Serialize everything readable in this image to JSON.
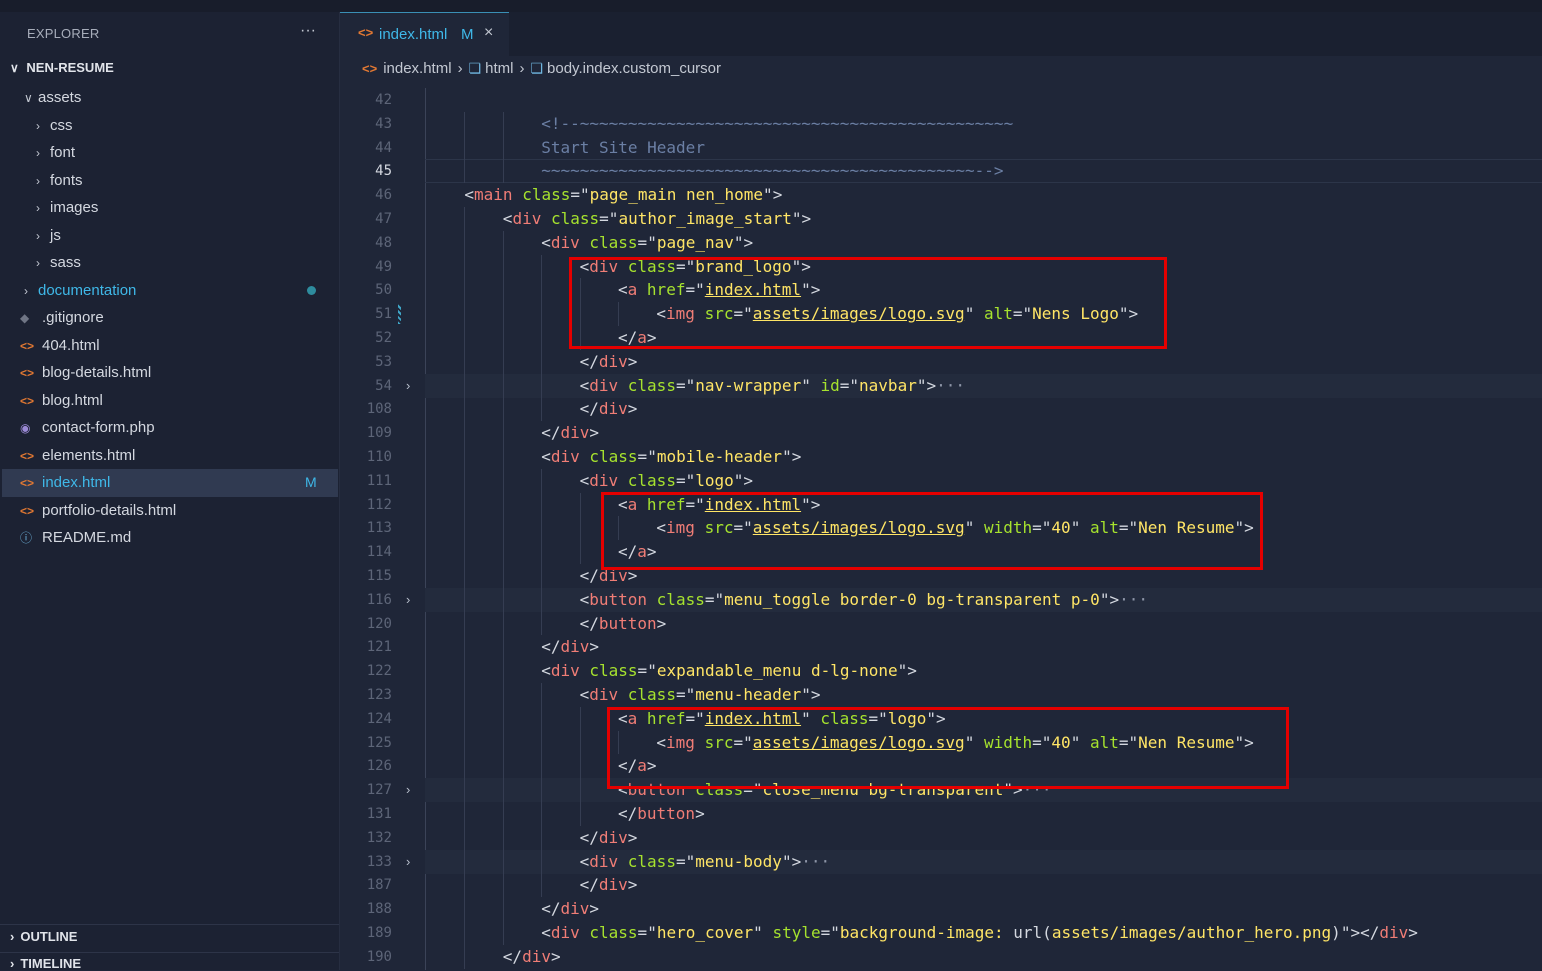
{
  "sidebar": {
    "header": "EXPLORER",
    "more": "···",
    "project": "NEN-RESUME",
    "items": [
      {
        "label": "assets",
        "type": "folder",
        "open": true
      },
      {
        "label": "css",
        "type": "folder"
      },
      {
        "label": "font",
        "type": "folder"
      },
      {
        "label": "fonts",
        "type": "folder"
      },
      {
        "label": "images",
        "type": "folder"
      },
      {
        "label": "js",
        "type": "folder"
      },
      {
        "label": "sass",
        "type": "folder"
      },
      {
        "label": "documentation",
        "type": "folder"
      },
      {
        "label": ".gitignore",
        "type": "file"
      },
      {
        "label": "404.html",
        "type": "file"
      },
      {
        "label": "blog-details.html",
        "type": "file"
      },
      {
        "label": "blog.html",
        "type": "file"
      },
      {
        "label": "contact-form.php",
        "type": "file"
      },
      {
        "label": "elements.html",
        "type": "file"
      },
      {
        "label": "index.html",
        "type": "file",
        "badge": "M"
      },
      {
        "label": "portfolio-details.html",
        "type": "file"
      },
      {
        "label": "README.md",
        "type": "file"
      }
    ],
    "outline": "OUTLINE",
    "timeline": "TIMELINE"
  },
  "editor": {
    "tab": {
      "label": "index.html",
      "badge": "M",
      "close": "×"
    },
    "breadcrumb": [
      "index.html",
      "html",
      "body.index.custom_cursor"
    ],
    "lines": [
      {
        "n": "42",
        "code": ""
      },
      {
        "n": "43",
        "code": "<!--~~~~~~~~~~~~~~~~~~~~~~~~~~~~~~~~~~~~~~~~~~~~~"
      },
      {
        "n": "44",
        "code": "Start Site Header"
      },
      {
        "n": "45",
        "code": "~~~~~~~~~~~~~~~~~~~~~~~~~~~~~~~~~~~~~~~~~~~~~-->"
      },
      {
        "n": "46",
        "code": "<main class=\"page_main nen_home\">"
      },
      {
        "n": "47",
        "code": "<div class=\"author_image_start\">"
      },
      {
        "n": "48",
        "code": "<div class=\"page_nav\">"
      },
      {
        "n": "49",
        "code": "<div class=\"brand_logo\">"
      },
      {
        "n": "50",
        "code": "<a href=\"index.html\">"
      },
      {
        "n": "51",
        "code": "<img src=\"assets/images/logo.svg\" alt=\"Nens Logo\">"
      },
      {
        "n": "52",
        "code": "</a>"
      },
      {
        "n": "53",
        "code": "</div>"
      },
      {
        "n": "54",
        "code": "<div class=\"nav-wrapper\" id=\"navbar\">···"
      },
      {
        "n": "108",
        "code": "</div>"
      },
      {
        "n": "109",
        "code": "</div>"
      },
      {
        "n": "110",
        "code": "<div class=\"mobile-header\">"
      },
      {
        "n": "111",
        "code": "<div class=\"logo\">"
      },
      {
        "n": "112",
        "code": "<a href=\"index.html\">"
      },
      {
        "n": "113",
        "code": "<img src=\"assets/images/logo.svg\" width=\"40\" alt=\"Nen Resume\">"
      },
      {
        "n": "114",
        "code": "</a>"
      },
      {
        "n": "115",
        "code": "</div>"
      },
      {
        "n": "116",
        "code": "<button class=\"menu_toggle border-0 bg-transparent p-0\">···"
      },
      {
        "n": "120",
        "code": "</button>"
      },
      {
        "n": "121",
        "code": "</div>"
      },
      {
        "n": "122",
        "code": "<div class=\"expandable_menu d-lg-none\">"
      },
      {
        "n": "123",
        "code": "<div class=\"menu-header\">"
      },
      {
        "n": "124",
        "code": "<a href=\"index.html\" class=\"logo\">"
      },
      {
        "n": "125",
        "code": "<img src=\"assets/images/logo.svg\" width=\"40\" alt=\"Nen Resume\">"
      },
      {
        "n": "126",
        "code": "</a>"
      },
      {
        "n": "127",
        "code": "<button class=\"close_menu bg-transparent\">···"
      },
      {
        "n": "131",
        "code": "</button>"
      },
      {
        "n": "132",
        "code": "</div>"
      },
      {
        "n": "133",
        "code": "<div class=\"menu-body\">···"
      },
      {
        "n": "187",
        "code": "</div>"
      },
      {
        "n": "188",
        "code": "</div>"
      },
      {
        "n": "189",
        "code": "<div class=\"hero_cover\" style=\"background-image: url(assets/images/author_hero.png)\"></div>"
      },
      {
        "n": "190",
        "code": "</div>"
      }
    ]
  }
}
